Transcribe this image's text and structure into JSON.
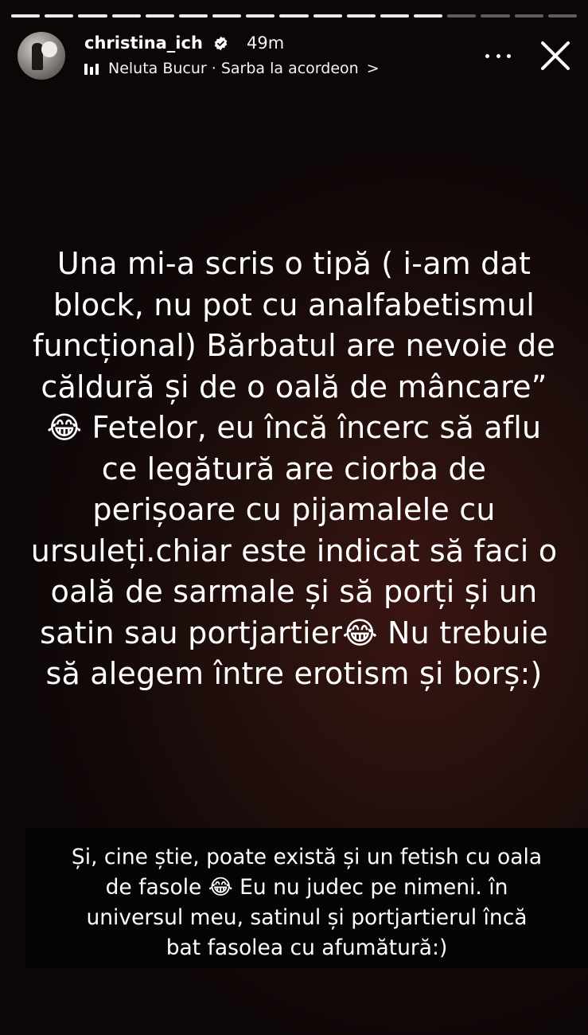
{
  "story": {
    "progress_segments": 17,
    "progress_done": 13,
    "username": "christina_ich",
    "time_ago": "49m",
    "music": "Neluta Bucur · Sarba la acordeon",
    "music_chevron": ">"
  },
  "main_text": {
    "lines": [
      "Una mi-a scris o tipă ( i-am dat",
      "block, nu pot cu analfabetismul",
      "funcțional) Bărbatul are nevoie de",
      "căldură și de o oală de mâncare”",
      "😂 Fetelor, eu încă încerc să aflu",
      "ce legătură are ciorba de",
      "perișoare cu pijamalele cu",
      "ursuleți.chiar este indicat să faci o",
      "oală de sarmale și să porți și un",
      "satin sau portjartier😂 Nu trebuie",
      "să alegem între erotism și borș:)"
    ]
  },
  "caption": {
    "lines": [
      "Și, cine știe, poate există și un fetish cu oala",
      "de fasole 😂 Eu nu judec pe nimeni. în",
      "universul meu, satinul și portjartierul încă",
      "bat fasolea cu afumătură:)"
    ]
  },
  "colors": {
    "background": "#140909",
    "text": "#ffffff",
    "caption_bg": "#070404"
  }
}
